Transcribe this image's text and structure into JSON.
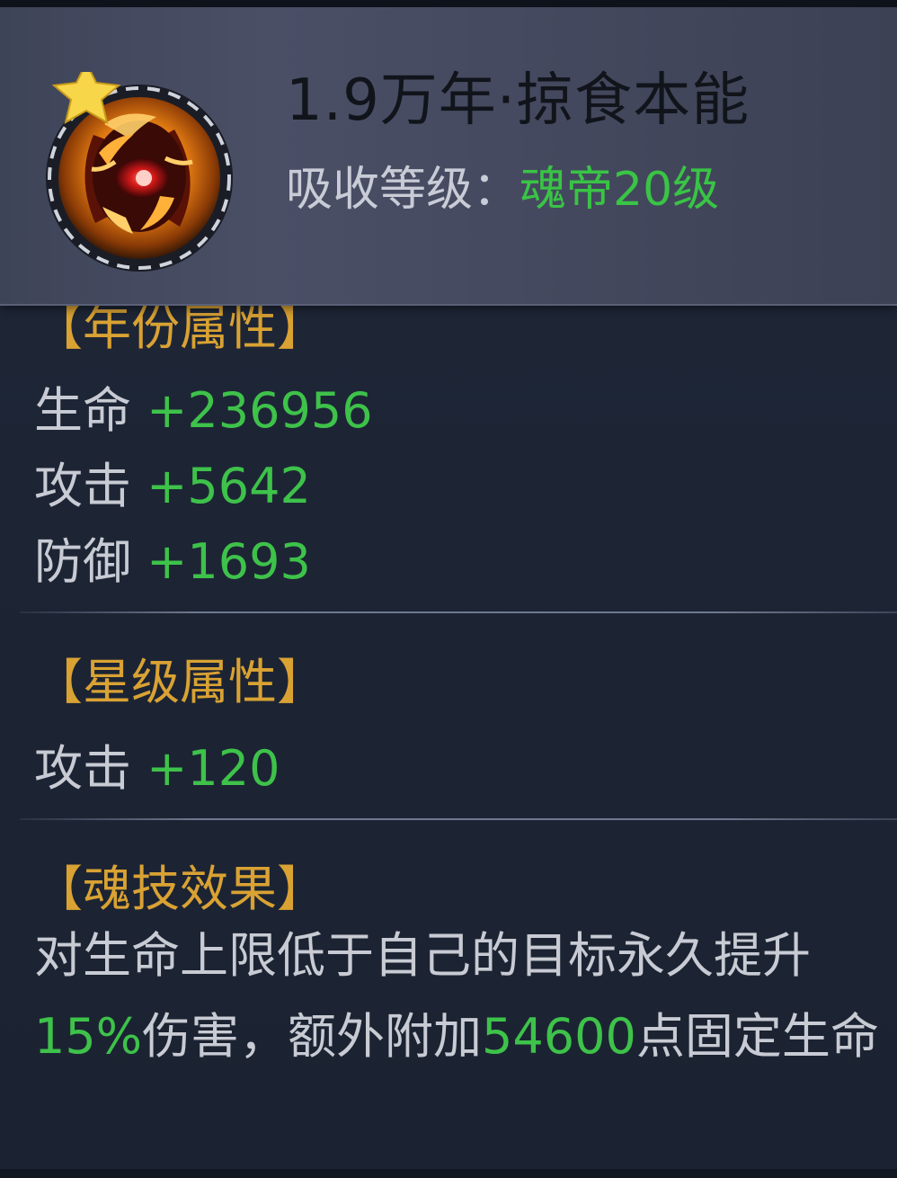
{
  "header": {
    "title": "1.9万年·掠食本能",
    "absorb_label": "吸收等级：",
    "absorb_value": "魂帝20级",
    "badge_icon": "predator-eye-icon",
    "star_icon": "star-icon",
    "star_count": 1
  },
  "year_attributes": {
    "bracket_open": "【",
    "title": "年份属性",
    "bracket_close": "】",
    "stats": [
      {
        "name": "生命",
        "value": "+236956"
      },
      {
        "name": "攻击",
        "value": "+5642"
      },
      {
        "name": "防御",
        "value": "+1693"
      }
    ]
  },
  "star_attributes": {
    "bracket_open": "【",
    "title": "星级属性",
    "bracket_close": "】",
    "stats": [
      {
        "name": "攻击",
        "value": "+120"
      }
    ]
  },
  "skill_effect": {
    "bracket_open": "【",
    "title": "魂技效果",
    "bracket_close": "】",
    "line1": "对生命上限低于自己的目标永久提升",
    "pct": "15%",
    "mid": "伤害，额外附加",
    "amount": "54600",
    "tail": "点固定生命"
  },
  "colors": {
    "accent_green": "#3ec24a",
    "section_gold": "#d9a233",
    "text_light": "#c8cbd3",
    "panel_bg": "#1c2433"
  }
}
